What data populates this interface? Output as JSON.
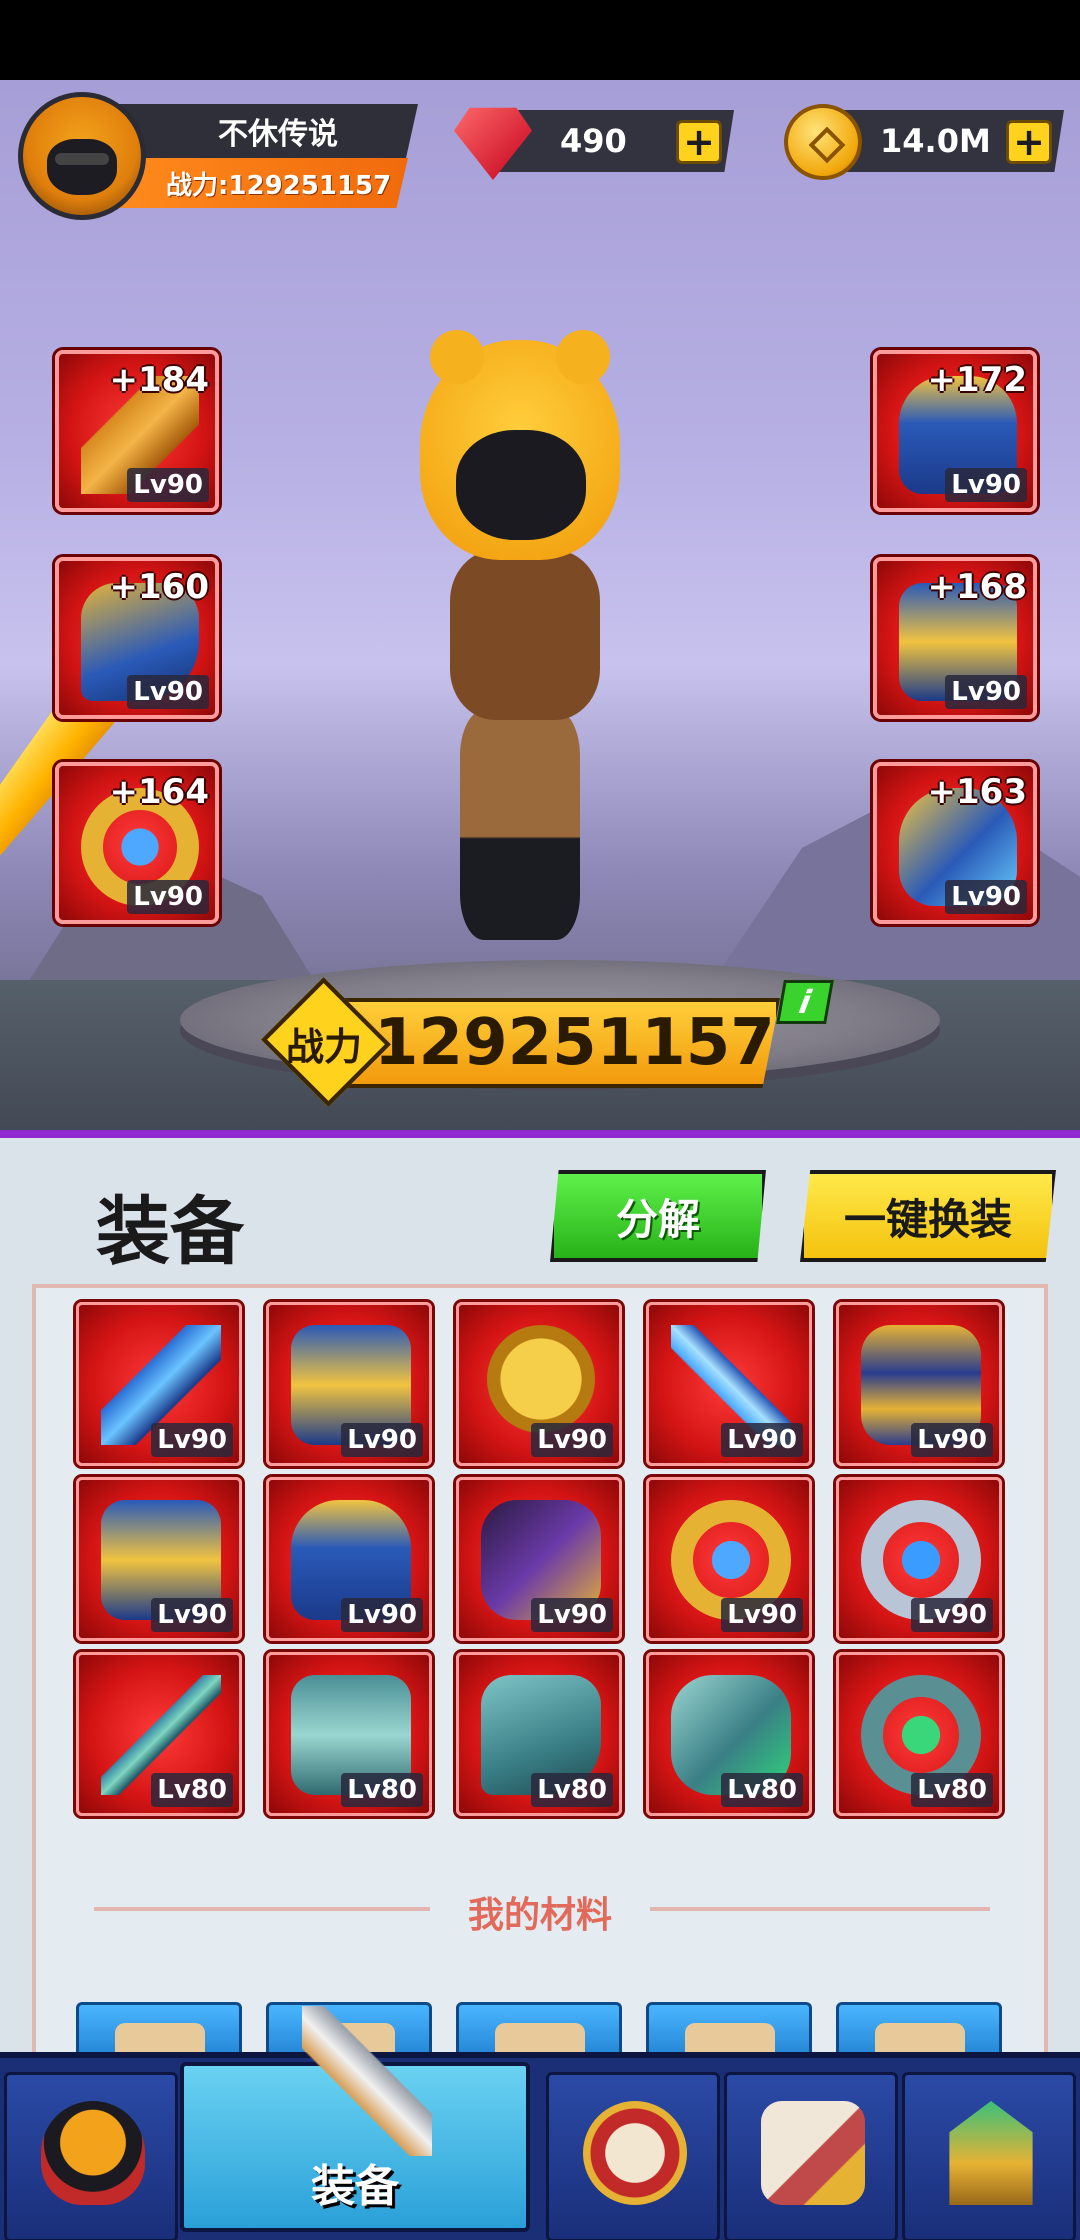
{
  "profile": {
    "name": "不休传说",
    "power_text": "战力:129251157"
  },
  "currency": {
    "gems": "490",
    "coins": "14.0M",
    "plus": "+"
  },
  "equipped": {
    "left": [
      {
        "plus": "+184",
        "level": "Lv90",
        "icon": "golden-axe-icon"
      },
      {
        "plus": "+160",
        "level": "Lv90",
        "icon": "blue-boots-icon"
      },
      {
        "plus": "+164",
        "level": "Lv90",
        "icon": "blue-ring-icon"
      }
    ],
    "right": [
      {
        "plus": "+172",
        "level": "Lv90",
        "icon": "blue-helmet-icon"
      },
      {
        "plus": "+168",
        "level": "Lv90",
        "icon": "blue-armor-icon"
      },
      {
        "plus": "+163",
        "level": "Lv90",
        "icon": "blue-gauntlet-icon"
      }
    ]
  },
  "combat_power": {
    "label": "战力",
    "value": "129251157",
    "info": "i"
  },
  "panel": {
    "title": "装备",
    "decompose_label": "分解",
    "one_key_label": "一键换装"
  },
  "inventory": [
    {
      "level": "Lv90",
      "icon": "spear-icon"
    },
    {
      "level": "Lv90",
      "icon": "golden-blue-sword-icon"
    },
    {
      "level": "Lv90",
      "icon": "lion-helmet-icon"
    },
    {
      "level": "Lv90",
      "icon": "crystal-sword-icon"
    },
    {
      "level": "Lv90",
      "icon": "golden-chestplate-icon"
    },
    {
      "level": "Lv90",
      "icon": "blue-armor-icon"
    },
    {
      "level": "Lv90",
      "icon": "golden-helmet-icon"
    },
    {
      "level": "Lv90",
      "icon": "purple-glove-icon"
    },
    {
      "level": "Lv90",
      "icon": "golden-ring-icon"
    },
    {
      "level": "Lv90",
      "icon": "silver-ring-icon"
    },
    {
      "level": "Lv80",
      "icon": "jade-staff-icon"
    },
    {
      "level": "Lv80",
      "icon": "jade-armor-icon"
    },
    {
      "level": "Lv80",
      "icon": "jade-boots-icon"
    },
    {
      "level": "Lv80",
      "icon": "jade-gauntlet-icon"
    },
    {
      "level": "Lv80",
      "icon": "jade-ring-icon"
    }
  ],
  "materials": {
    "label": "我的材料"
  },
  "nav": {
    "active_label": "装备",
    "tabs": [
      "hero-icon",
      "equipment-icon",
      "drum-icon",
      "scroll-icon",
      "temple-icon"
    ]
  }
}
